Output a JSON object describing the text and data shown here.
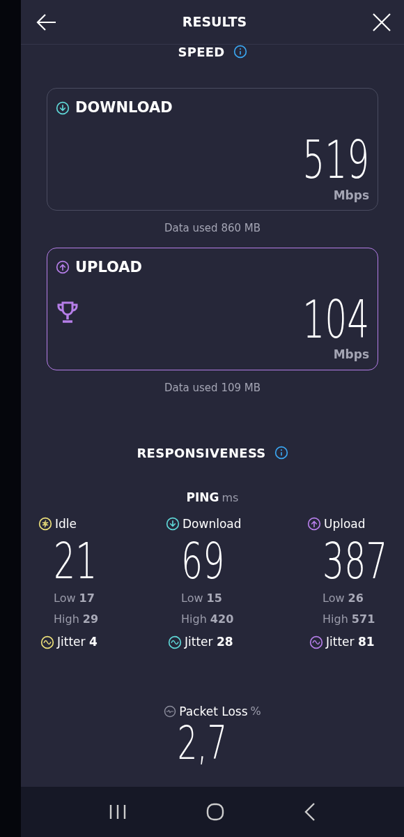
{
  "header": {
    "title": "RESULTS"
  },
  "speed": {
    "title": "SPEED",
    "cards": [
      {
        "label": "DOWNLOAD",
        "kind": "down",
        "color": "#5fd7d7",
        "value": "519",
        "unit": "Mbps",
        "highlighted": false,
        "trophy": false,
        "data_used": "Data used 860 MB"
      },
      {
        "label": "UPLOAD",
        "kind": "up",
        "color": "#b57ee8",
        "value": "104",
        "unit": "Mbps",
        "highlighted": true,
        "trophy": true,
        "data_used": "Data used 109 MB"
      }
    ]
  },
  "responsiveness": {
    "title": "RESPONSIVENESS",
    "ping_label": "PING",
    "ping_unit": "ms",
    "columns": [
      {
        "label": "Idle",
        "kind": "idle",
        "color": "#ede07a",
        "value": "21",
        "low_label": "Low",
        "low": "17",
        "high_label": "High",
        "high": "29",
        "jitter_label": "Jitter",
        "jitter": "4"
      },
      {
        "label": "Download",
        "kind": "down",
        "color": "#5fd7d7",
        "value": "69",
        "low_label": "Low",
        "low": "15",
        "high_label": "High",
        "high": "420",
        "jitter_label": "Jitter",
        "jitter": "28"
      },
      {
        "label": "Upload",
        "kind": "up",
        "color": "#b57ee8",
        "value": "387",
        "low_label": "Low",
        "low": "26",
        "high_label": "High",
        "high": "571",
        "jitter_label": "Jitter",
        "jitter": "81"
      }
    ],
    "packet_loss": {
      "label": "Packet Loss",
      "unit": "%",
      "value": "2,7"
    }
  }
}
